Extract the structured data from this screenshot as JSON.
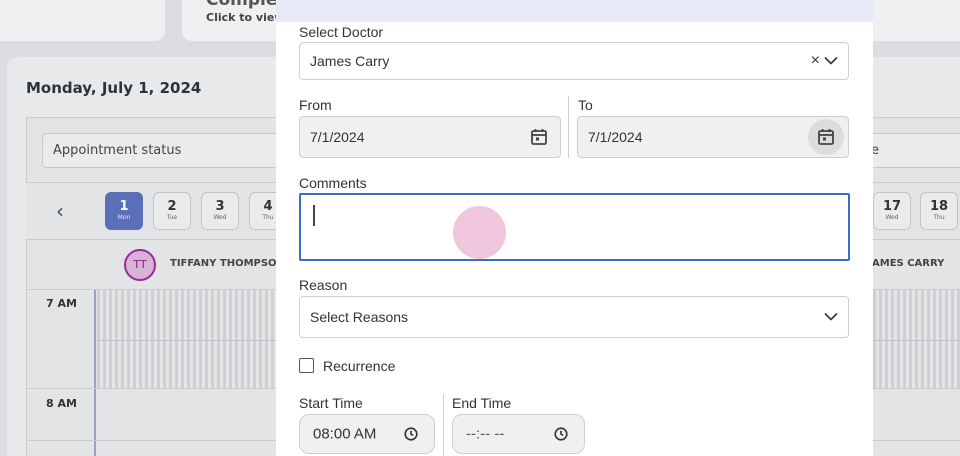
{
  "background": {
    "cards": [
      {
        "title": "Comple",
        "subtitle": "Click to view"
      }
    ],
    "calendar": {
      "date_heading": "Monday, July 1, 2024",
      "appointment_status_placeholder": "Appointment status",
      "right_filter_fragment": "e",
      "prev_icon": "‹",
      "days": [
        {
          "num": "1",
          "weekday": "Mon"
        },
        {
          "num": "2",
          "weekday": "Tue"
        },
        {
          "num": "3",
          "weekday": "Wed"
        },
        {
          "num": "4",
          "weekday": "Thu"
        },
        {
          "num": "17",
          "weekday": "Wed"
        },
        {
          "num": "18",
          "weekday": "Thu"
        }
      ],
      "doctors": [
        {
          "initials": "TT",
          "name": "TIFFANY THOMPSO"
        },
        {
          "name": "AMES CARRY"
        }
      ],
      "times": [
        "7 AM",
        "8 AM"
      ]
    }
  },
  "modal": {
    "select_doctor": {
      "label": "Select Doctor",
      "value": "James Carry",
      "clear_icon": "×"
    },
    "from": {
      "label": "From",
      "value": "7/1/2024"
    },
    "to": {
      "label": "To",
      "value": "7/1/2024"
    },
    "comments": {
      "label": "Comments",
      "value": ""
    },
    "reason": {
      "label": "Reason",
      "placeholder": "Select Reasons"
    },
    "recurrence": {
      "label": "Recurrence",
      "checked": false
    },
    "start_time": {
      "label": "Start Time",
      "value": "08:00 AM"
    },
    "end_time": {
      "label": "End Time",
      "value": "--:-- --"
    }
  },
  "colors": {
    "accent": "#3c6cc8",
    "active_day": "#5b6fb8",
    "avatar": "#9b2a9b"
  }
}
